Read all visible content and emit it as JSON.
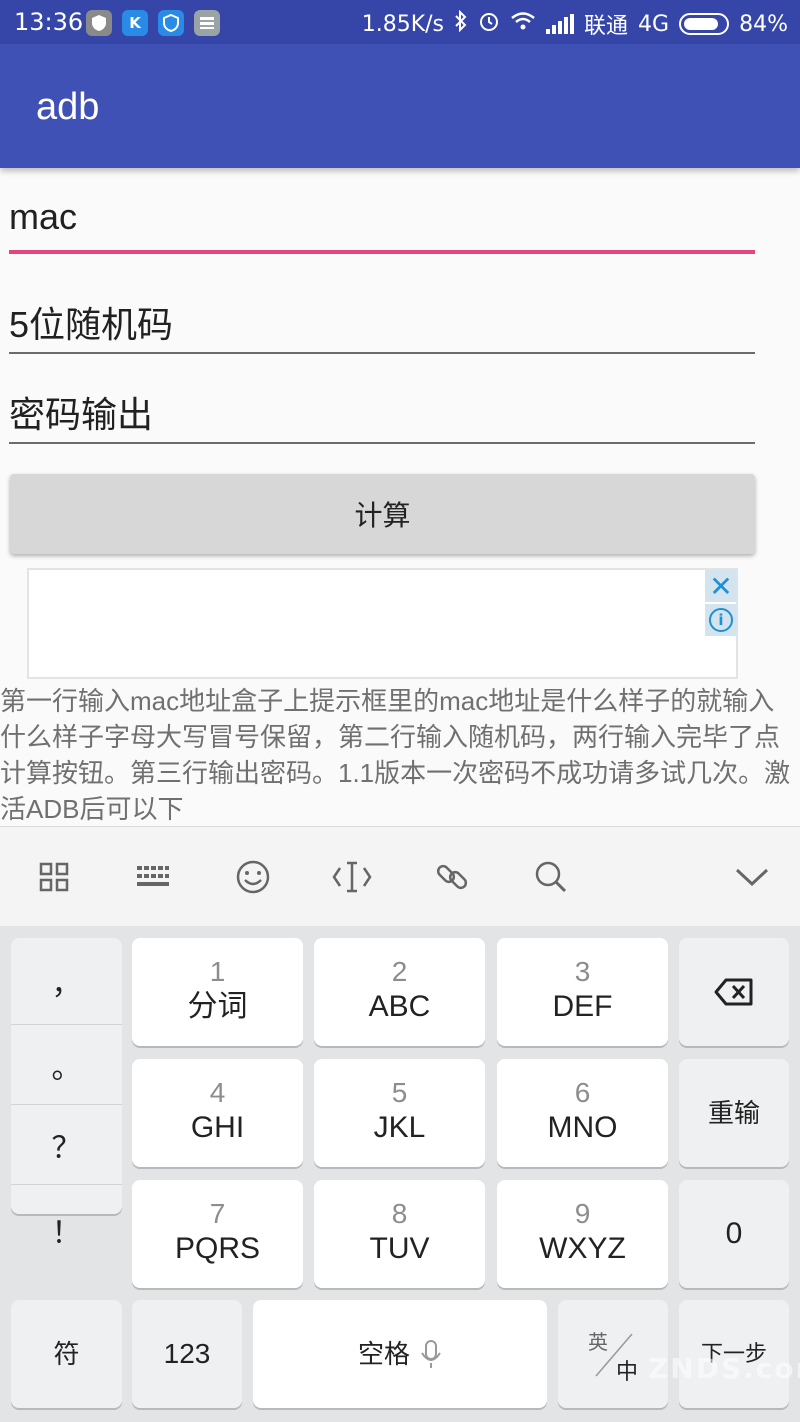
{
  "status_bar": {
    "time": "13:36",
    "net_speed": "1.85K/s",
    "carrier": "联通",
    "network": "4G",
    "battery": "84%",
    "battery_level": 0.84,
    "notif_icons": [
      "shield-icon",
      "k-icon",
      "badge-icon",
      "message-icon"
    ]
  },
  "app_bar": {
    "title": "adb"
  },
  "form": {
    "mac_value": "mac",
    "random_code_placeholder": "5位随机码",
    "password_output_placeholder": "密码输出",
    "calc_button": "计算"
  },
  "ad": {
    "close": "✕",
    "info": "i"
  },
  "description": "第一行输入mac地址盒子上提示框里的mac地址是什么样子的就输入什么样子字母大写冒号保留，第二行输入随机码，两行输入完毕了点计算按钮。第三行输出密码。1.1版本一次密码不成功请多试几次。激活ADB后可以下",
  "toolbar": {
    "icons": [
      "grid-icon",
      "keyboard-icon",
      "emoji-icon",
      "cursor-icon",
      "link-icon",
      "search-icon",
      "chevron-down-icon"
    ]
  },
  "keyboard": {
    "punct": [
      "，",
      "。",
      "？",
      "！"
    ],
    "keys": [
      {
        "num": "1",
        "letters": "分词"
      },
      {
        "num": "2",
        "letters": "ABC"
      },
      {
        "num": "3",
        "letters": "DEF"
      },
      {
        "num": "4",
        "letters": "GHI"
      },
      {
        "num": "5",
        "letters": "JKL"
      },
      {
        "num": "6",
        "letters": "MNO"
      },
      {
        "num": "7",
        "letters": "PQRS"
      },
      {
        "num": "8",
        "letters": "TUV"
      },
      {
        "num": "9",
        "letters": "WXYZ"
      }
    ],
    "reinput": "重输",
    "zero": "0",
    "symbol": "符",
    "numbers": "123",
    "space": "空格",
    "lang_top": "英",
    "lang_bottom": "中",
    "next": "下一步"
  },
  "watermark": "ZNDS.com",
  "colors": {
    "app_bar": "#3f51b5",
    "status_bar": "#3546a8",
    "accent": "#e2467a",
    "ad_icon": "#1f8fd6"
  }
}
